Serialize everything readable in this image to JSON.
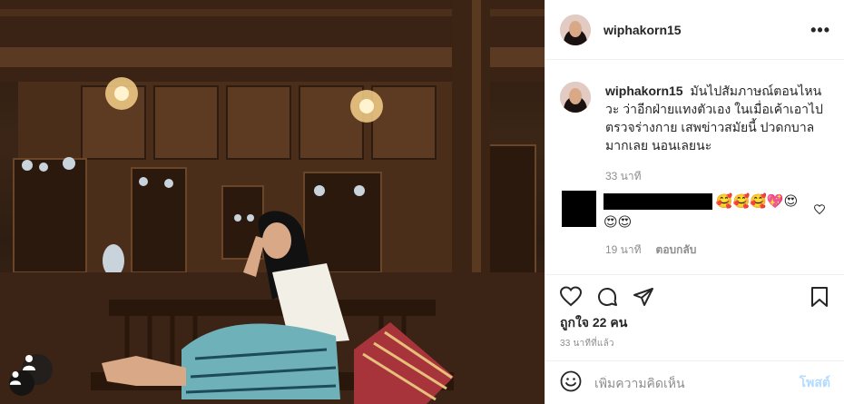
{
  "post": {
    "username": "wiphakorn15",
    "more_label": "•••",
    "caption_text": "มันไปสัมภาษณ์ตอนไหนวะ ว่าอีกฝ่ายแทงตัวเอง ในเมื่อเค้าเอาไปตรวจร่างกาย เสพข่าวสมัยนี้ ปวดกบาลมากเลย นอนเลยนะ",
    "caption_time": "33 นาที",
    "likes": "ถูกใจ 22 คน",
    "post_time": "33 นาทีที่แล้ว"
  },
  "comment": {
    "emojis": "🥰🥰🥰💖😍😍😍",
    "time": "19 นาที",
    "reply_label": "ตอบกลับ"
  },
  "add_comment": {
    "placeholder": "เพิ่มความคิดเห็น",
    "post_label": "โพสต์"
  },
  "icons": {
    "like": "heart-icon",
    "comment": "comment-icon",
    "share": "share-icon",
    "save": "bookmark-icon",
    "emoji": "emoji-icon",
    "user_tag": "user-icon"
  },
  "colors": {
    "text": "#262626",
    "muted": "#8e8e8e",
    "post_button_disabled": "#b3dbff",
    "border": "#efefef"
  }
}
